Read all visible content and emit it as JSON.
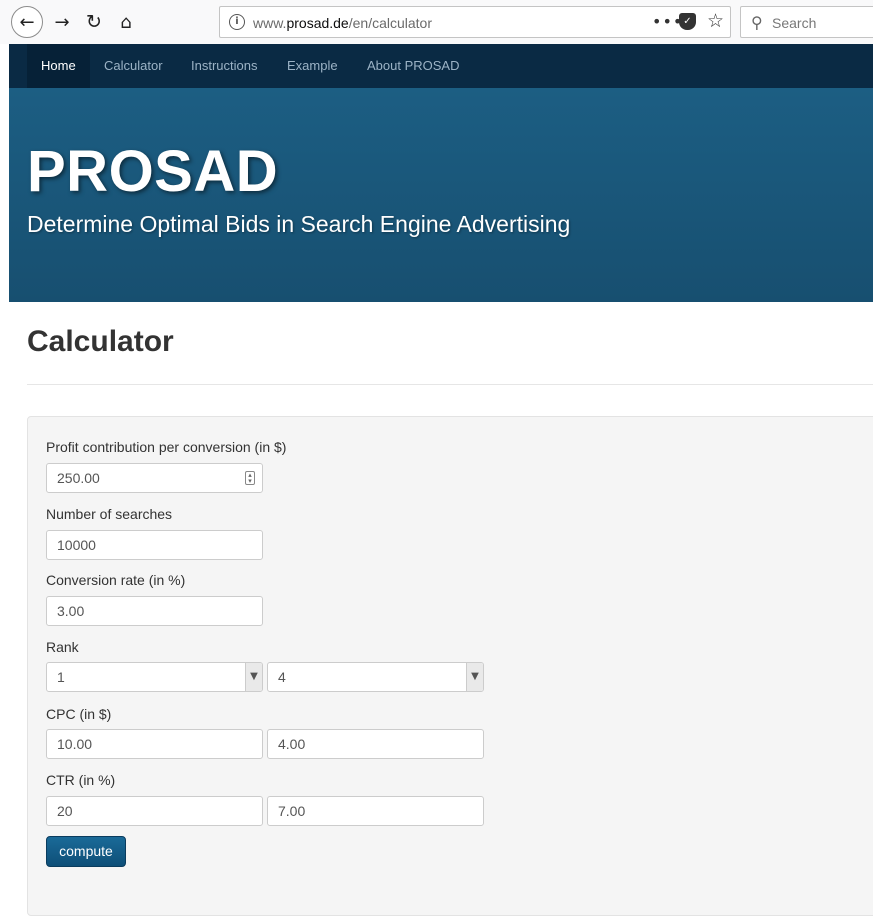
{
  "browser": {
    "url_prefix": "www.",
    "url_host": "prosad.de",
    "url_path": "/en/calculator",
    "search_placeholder": "Search",
    "icons": [
      "back-icon",
      "forward-icon",
      "reload-icon",
      "home-icon",
      "info-icon",
      "page-actions-icon",
      "pocket-icon",
      "bookmark-star-icon",
      "search-icon"
    ]
  },
  "nav": {
    "items": [
      {
        "label": "Home",
        "active": true
      },
      {
        "label": "Calculator",
        "active": false
      },
      {
        "label": "Instructions",
        "active": false
      },
      {
        "label": "Example",
        "active": false
      },
      {
        "label": "About PROSAD",
        "active": false
      }
    ]
  },
  "hero": {
    "title": "PROSAD",
    "subtitle": "Determine Optimal Bids in Search Engine Advertising"
  },
  "page": {
    "title": "Calculator"
  },
  "form": {
    "profit_label": "Profit contribution per conversion (in $)",
    "profit_value": "250.00",
    "searches_label": "Number of searches",
    "searches_value": "10000",
    "conversion_label": "Conversion rate (in %)",
    "conversion_value": "3.00",
    "rank_label": "Rank",
    "rank_1": "1",
    "rank_2": "4",
    "cpc_label": "CPC (in $)",
    "cpc_1": "10.00",
    "cpc_2": "4.00",
    "ctr_label": "CTR (in %)",
    "ctr_1": "20",
    "ctr_2": "7.00",
    "compute_label": "compute"
  },
  "colors": {
    "nav_bg": "#0a2a44",
    "hero_bg": "#1c5e83",
    "button_bg": "#115a85"
  }
}
